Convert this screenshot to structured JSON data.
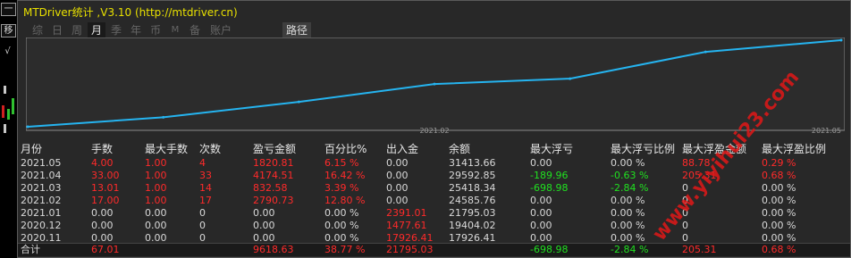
{
  "window": {
    "title": "MTDriver统计 ,V3.10 (http://mtdriver.cn)"
  },
  "left_strip": {
    "buttons": [
      "一",
      "移",
      "√"
    ]
  },
  "tabs": [
    {
      "label": "综",
      "active": false
    },
    {
      "label": "日",
      "active": false
    },
    {
      "label": "周",
      "active": false
    },
    {
      "label": "月",
      "active": true
    },
    {
      "label": "季",
      "active": false
    },
    {
      "label": "年",
      "active": false
    },
    {
      "label": "币",
      "active": false
    },
    {
      "label": "M",
      "active": false
    },
    {
      "label": "备",
      "active": false
    },
    {
      "label": "账户",
      "active": false
    }
  ],
  "path_button": "路径",
  "chart_data": {
    "type": "line",
    "x": [
      "2020.11",
      "2020.12",
      "2021.01",
      "2021.02",
      "2021.03",
      "2021.04",
      "2021.05"
    ],
    "series": [
      {
        "values": [
          17926.41,
          19404.02,
          21795.03,
          24585.76,
          25418.34,
          29592.85,
          31413.66
        ]
      }
    ],
    "tick_labels": [
      "2021.02",
      "2021.05"
    ],
    "ylim": [
      17926.41,
      31413.66
    ],
    "line_color": "#25b4f0",
    "grid": false
  },
  "table": {
    "headers": [
      "月份",
      "手数",
      "最大手数",
      "次数",
      "盈亏金额",
      "百分比%",
      "出入金",
      "余额",
      "最大浮亏",
      "最大浮亏比例",
      "最大浮盈金额",
      "最大浮盈比例"
    ],
    "rows": [
      [
        {
          "t": "2021.05",
          "c": "w"
        },
        {
          "t": "4.00",
          "c": "r"
        },
        {
          "t": "1.00",
          "c": "r"
        },
        {
          "t": "4",
          "c": "r"
        },
        {
          "t": "1820.81",
          "c": "r"
        },
        {
          "t": "6.15 %",
          "c": "r"
        },
        {
          "t": "0.00",
          "c": "w"
        },
        {
          "t": "31413.66",
          "c": "w"
        },
        {
          "t": "0.00",
          "c": "w"
        },
        {
          "t": "0.00 %",
          "c": "w"
        },
        {
          "t": "88.78",
          "c": "r"
        },
        {
          "t": "0.29 %",
          "c": "r"
        }
      ],
      [
        {
          "t": "2021.04",
          "c": "w"
        },
        {
          "t": "33.00",
          "c": "r"
        },
        {
          "t": "1.00",
          "c": "r"
        },
        {
          "t": "33",
          "c": "r"
        },
        {
          "t": "4174.51",
          "c": "r"
        },
        {
          "t": "16.42 %",
          "c": "r"
        },
        {
          "t": "0.00",
          "c": "w"
        },
        {
          "t": "29592.85",
          "c": "w"
        },
        {
          "t": "-189.96",
          "c": "g"
        },
        {
          "t": "-0.63 %",
          "c": "g"
        },
        {
          "t": "205.31",
          "c": "r"
        },
        {
          "t": "0.68 %",
          "c": "r"
        }
      ],
      [
        {
          "t": "2021.03",
          "c": "w"
        },
        {
          "t": "13.01",
          "c": "r"
        },
        {
          "t": "1.00",
          "c": "r"
        },
        {
          "t": "14",
          "c": "r"
        },
        {
          "t": "832.58",
          "c": "r"
        },
        {
          "t": "3.39 %",
          "c": "r"
        },
        {
          "t": "0.00",
          "c": "w"
        },
        {
          "t": "25418.34",
          "c": "w"
        },
        {
          "t": "-698.98",
          "c": "g"
        },
        {
          "t": "-2.84 %",
          "c": "g"
        },
        {
          "t": "0",
          "c": "w"
        },
        {
          "t": "0.00 %",
          "c": "w"
        }
      ],
      [
        {
          "t": "2021.02",
          "c": "w"
        },
        {
          "t": "17.00",
          "c": "r"
        },
        {
          "t": "1.00",
          "c": "r"
        },
        {
          "t": "17",
          "c": "r"
        },
        {
          "t": "2790.73",
          "c": "r"
        },
        {
          "t": "12.80 %",
          "c": "r"
        },
        {
          "t": "0.00",
          "c": "w"
        },
        {
          "t": "24585.76",
          "c": "w"
        },
        {
          "t": "0.00",
          "c": "w"
        },
        {
          "t": "0.00 %",
          "c": "w"
        },
        {
          "t": "0",
          "c": "w"
        },
        {
          "t": "0.00 %",
          "c": "w"
        }
      ],
      [
        {
          "t": "2021.01",
          "c": "w"
        },
        {
          "t": "0.00",
          "c": "w"
        },
        {
          "t": "0.00",
          "c": "w"
        },
        {
          "t": "0",
          "c": "w"
        },
        {
          "t": "0.00",
          "c": "w"
        },
        {
          "t": "0.00 %",
          "c": "w"
        },
        {
          "t": "2391.01",
          "c": "r"
        },
        {
          "t": "21795.03",
          "c": "w"
        },
        {
          "t": "0.00",
          "c": "w"
        },
        {
          "t": "0.00 %",
          "c": "w"
        },
        {
          "t": "0",
          "c": "w"
        },
        {
          "t": "0.00 %",
          "c": "w"
        }
      ],
      [
        {
          "t": "2020.12",
          "c": "w"
        },
        {
          "t": "0.00",
          "c": "w"
        },
        {
          "t": "0.00",
          "c": "w"
        },
        {
          "t": "0",
          "c": "w"
        },
        {
          "t": "0.00",
          "c": "w"
        },
        {
          "t": "0.00 %",
          "c": "w"
        },
        {
          "t": "1477.61",
          "c": "r"
        },
        {
          "t": "19404.02",
          "c": "w"
        },
        {
          "t": "0.00",
          "c": "w"
        },
        {
          "t": "0.00 %",
          "c": "w"
        },
        {
          "t": "0",
          "c": "w"
        },
        {
          "t": "0.00 %",
          "c": "w"
        }
      ],
      [
        {
          "t": "2020.11",
          "c": "w"
        },
        {
          "t": "0.00",
          "c": "w"
        },
        {
          "t": "0.00",
          "c": "w"
        },
        {
          "t": "0",
          "c": "w"
        },
        {
          "t": "0.00",
          "c": "w"
        },
        {
          "t": "0.00 %",
          "c": "w"
        },
        {
          "t": "17926.41",
          "c": "r"
        },
        {
          "t": "17926.41",
          "c": "w"
        },
        {
          "t": "0.00",
          "c": "w"
        },
        {
          "t": "0.00 %",
          "c": "w"
        },
        {
          "t": "0",
          "c": "w"
        },
        {
          "t": "0.00 %",
          "c": "w"
        }
      ]
    ],
    "total": [
      {
        "t": "合计",
        "c": "w"
      },
      {
        "t": "67.01",
        "c": "r"
      },
      {
        "t": "",
        "c": "w"
      },
      {
        "t": "",
        "c": "w"
      },
      {
        "t": "9618.63",
        "c": "r"
      },
      {
        "t": "38.77 %",
        "c": "r"
      },
      {
        "t": "21795.03",
        "c": "r"
      },
      {
        "t": "",
        "c": "w"
      },
      {
        "t": "-698.98",
        "c": "g"
      },
      {
        "t": "-2.84 %",
        "c": "g"
      },
      {
        "t": "205.31",
        "c": "r"
      },
      {
        "t": "0.68 %",
        "c": "r"
      }
    ]
  },
  "watermark": {
    "text": "www.yiyihui23.com",
    "color": "#e01818"
  },
  "colors": {
    "profit": "#ff2a2a",
    "loss": "#20e020",
    "title": "#e8e000",
    "text": "#d8d8d8"
  }
}
